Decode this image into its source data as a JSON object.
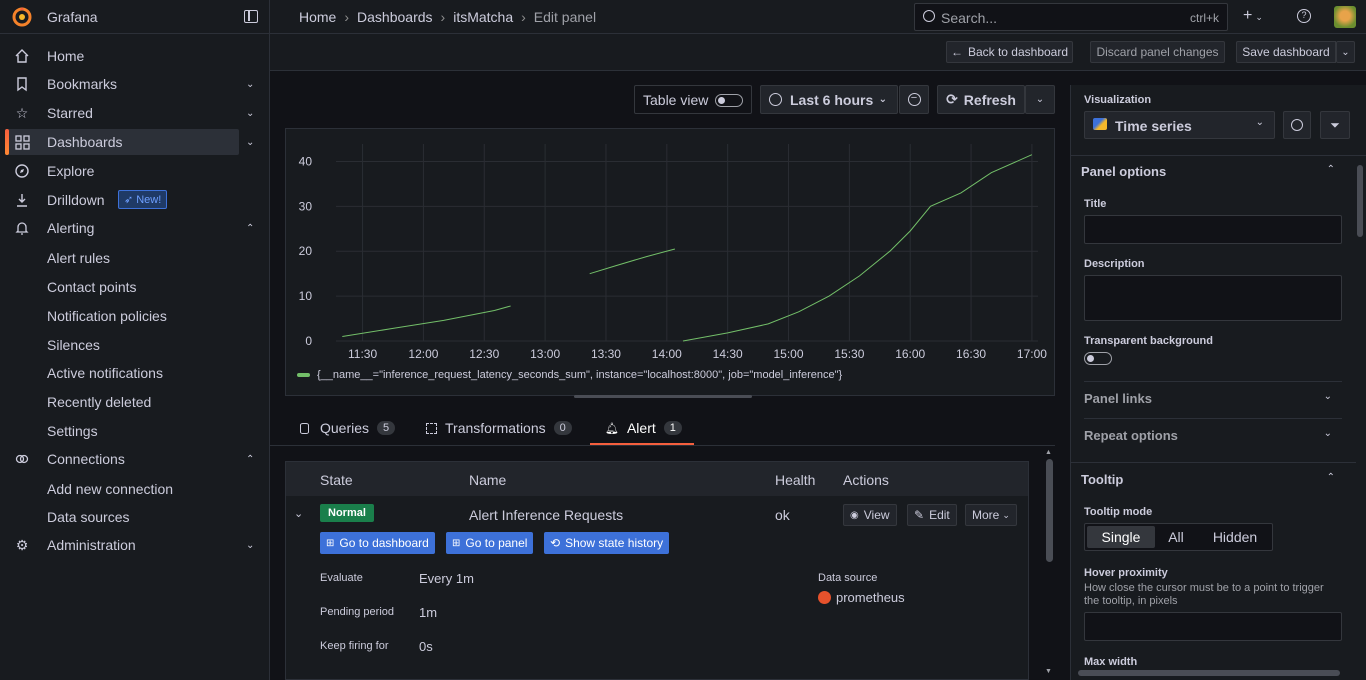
{
  "app": {
    "name": "Grafana"
  },
  "breadcrumb": [
    "Home",
    "Dashboards",
    "itsMatcha",
    "Edit panel"
  ],
  "search": {
    "placeholder": "Search...",
    "shortcut": "ctrl+k"
  },
  "toolbar": {
    "back": "Back to dashboard",
    "discard": "Discard panel changes",
    "save": "Save dashboard"
  },
  "nav": {
    "items": [
      "Home",
      "Bookmarks",
      "Starred",
      "Dashboards",
      "Explore",
      "Drilldown",
      "Alerting"
    ],
    "drilldown_badge": "New!",
    "alerting_sub": [
      "Alert rules",
      "Contact points",
      "Notification policies",
      "Silences",
      "Active notifications",
      "Recently deleted",
      "Settings"
    ],
    "connections": "Connections",
    "connections_sub": [
      "Add new connection",
      "Data sources"
    ],
    "administration": "Administration"
  },
  "panel_controls": {
    "table_view": "Table view",
    "time_range": "Last 6 hours",
    "refresh": "Refresh"
  },
  "chart_data": {
    "type": "line",
    "x_ticks": [
      "11:30",
      "12:00",
      "12:30",
      "13:00",
      "13:30",
      "14:00",
      "14:30",
      "15:00",
      "15:30",
      "16:00",
      "16:30",
      "17:00"
    ],
    "y_ticks": [
      "0",
      "10",
      "20",
      "30",
      "40"
    ],
    "ylim": [
      0,
      45
    ],
    "series": [
      {
        "name": "{__name__=\"inference_request_latency_seconds_sum\", instance=\"localhost:8000\", job=\"model_inference\"}",
        "color": "#73bf69",
        "segments": [
          [
            [
              "11:20",
              1.0
            ],
            [
              "11:45",
              2.8
            ],
            [
              "12:10",
              4.6
            ],
            [
              "12:35",
              6.8
            ],
            [
              "12:43",
              7.8
            ]
          ],
          [
            [
              "13:22",
              15.0
            ],
            [
              "13:35",
              16.8
            ],
            [
              "13:50",
              18.8
            ],
            [
              "14:04",
              20.5
            ]
          ],
          [
            [
              "14:08",
              0.0
            ],
            [
              "14:30",
              1.8
            ],
            [
              "14:50",
              3.8
            ],
            [
              "15:05",
              6.5
            ],
            [
              "15:20",
              10.0
            ],
            [
              "15:35",
              14.5
            ],
            [
              "15:50",
              20.0
            ],
            [
              "16:00",
              24.5
            ],
            [
              "16:10",
              30.0
            ],
            [
              "16:25",
              33.0
            ],
            [
              "16:40",
              37.5
            ],
            [
              "17:00",
              41.5
            ]
          ]
        ]
      }
    ]
  },
  "tabs": [
    {
      "label": "Queries",
      "count": "5"
    },
    {
      "label": "Transformations",
      "count": "0"
    },
    {
      "label": "Alert",
      "count": "1"
    }
  ],
  "alert_table": {
    "headers": [
      "State",
      "Name",
      "Health",
      "Actions"
    ],
    "row": {
      "state": "Normal",
      "name": "Alert Inference Requests",
      "health": "ok"
    },
    "actions": [
      "View",
      "Edit",
      "More"
    ],
    "links": [
      "Go to dashboard",
      "Go to panel",
      "Show state history"
    ],
    "evaluate_label": "Evaluate",
    "evaluate": "Every 1m",
    "pending_label": "Pending period",
    "pending": "1m",
    "keep_label": "Keep firing for",
    "keep": "0s",
    "datasource_label": "Data source",
    "datasource": "prometheus"
  },
  "options": {
    "visualization_label": "Visualization",
    "visualization": "Time series",
    "panel_options": "Panel options",
    "title_label": "Title",
    "description_label": "Description",
    "transparent_label": "Transparent background",
    "panel_links": "Panel links",
    "repeat_options": "Repeat options",
    "tooltip": "Tooltip",
    "tooltip_mode_label": "Tooltip mode",
    "tooltip_modes": [
      "Single",
      "All",
      "Hidden"
    ],
    "hover_label": "Hover proximity",
    "hover_desc": "How close the cursor must be to a point to trigger the tooltip, in pixels",
    "max_width": "Max width"
  }
}
